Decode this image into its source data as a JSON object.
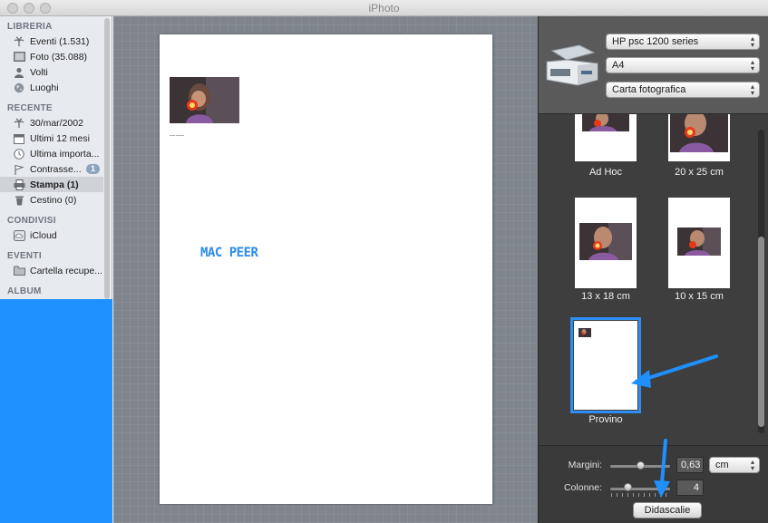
{
  "window": {
    "title": "iPhoto"
  },
  "sidebar": {
    "sections": [
      {
        "title": "LIBRERIA",
        "items": [
          {
            "label": "Eventi (1.531)",
            "icon": "palm-tree-icon"
          },
          {
            "label": "Foto (35.088)",
            "icon": "photos-icon"
          },
          {
            "label": "Volti",
            "icon": "person-icon"
          },
          {
            "label": "Luoghi",
            "icon": "globe-icon"
          }
        ]
      },
      {
        "title": "RECENTE",
        "items": [
          {
            "label": "30/mar/2002",
            "icon": "palm-tree-icon"
          },
          {
            "label": "Ultimi 12 mesi",
            "icon": "calendar-icon"
          },
          {
            "label": "Ultima importa...",
            "icon": "clock-icon"
          },
          {
            "label": "Contrasse...",
            "icon": "flag-icon",
            "badge": "1"
          },
          {
            "label": "Stampa (1)",
            "icon": "printer-icon",
            "selected": true
          },
          {
            "label": "Cestino (0)",
            "icon": "trash-icon"
          }
        ]
      },
      {
        "title": "CONDIVISI",
        "items": [
          {
            "label": "iCloud",
            "icon": "cloud-icon"
          }
        ]
      },
      {
        "title": "EVENTI",
        "items": [
          {
            "label": "Cartella recupe...",
            "icon": "folder-icon"
          }
        ]
      },
      {
        "title": "ALBUM",
        "items": []
      }
    ]
  },
  "canvas": {
    "watermark": "MAC PEER"
  },
  "print_panel": {
    "printer": "HP psc 1200 series",
    "paper_size": "A4",
    "paper_type": "Carta fotografica",
    "themes": [
      {
        "label": "Ad Hoc"
      },
      {
        "label": "20 x 25 cm"
      },
      {
        "label": "13 x 18 cm"
      },
      {
        "label": "10 x 15 cm"
      },
      {
        "label": "Provino",
        "selected": true
      }
    ],
    "margini_label": "Margini:",
    "margini_value": "0,63",
    "margini_unit": "cm",
    "colonne_label": "Colonne:",
    "colonne_value": "4",
    "didascalie_button": "Didascalie"
  },
  "colors": {
    "accent": "#2d8ef5",
    "annotation": "#1e90ff"
  }
}
